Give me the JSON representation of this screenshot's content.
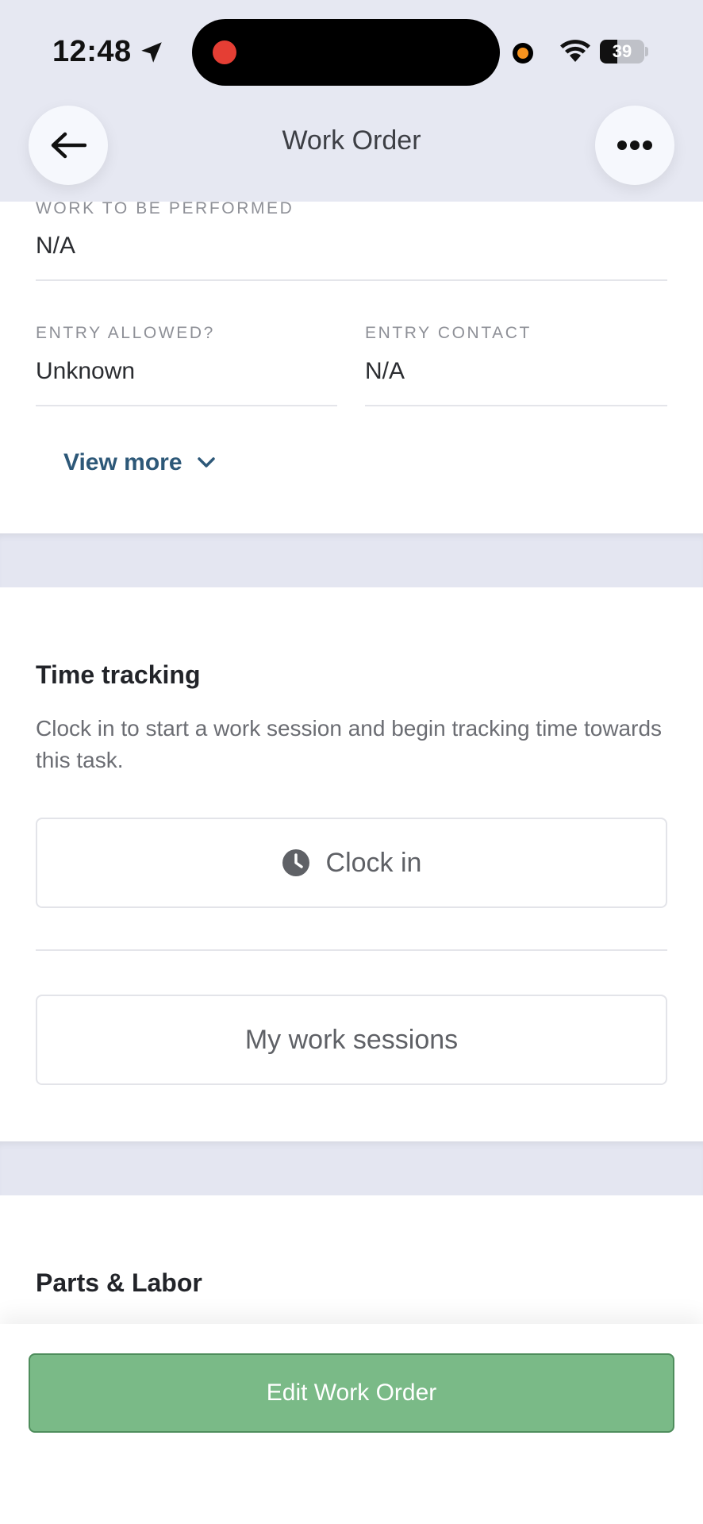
{
  "status_bar": {
    "time": "12:48",
    "battery": "39",
    "battery_level": 0.39
  },
  "header": {
    "title": "Work Order"
  },
  "details": {
    "work_to_be_performed": {
      "label": "WORK TO BE PERFORMED",
      "value": "N/A"
    },
    "entry_allowed": {
      "label": "ENTRY ALLOWED?",
      "value": "Unknown"
    },
    "entry_contact": {
      "label": "ENTRY CONTACT",
      "value": "N/A"
    },
    "view_more_label": "View more"
  },
  "time_tracking": {
    "title": "Time tracking",
    "description": "Clock in to start a work session and begin tracking time towards this task.",
    "clock_in_label": "Clock in",
    "sessions_label": "My work sessions"
  },
  "parts_labor": {
    "title": "Parts & Labor"
  },
  "footer": {
    "edit_label": "Edit Work Order"
  },
  "colors": {
    "accent_link": "#2d5878",
    "edit_button": "#7aba87",
    "header_bg": "#e6e8f2"
  }
}
